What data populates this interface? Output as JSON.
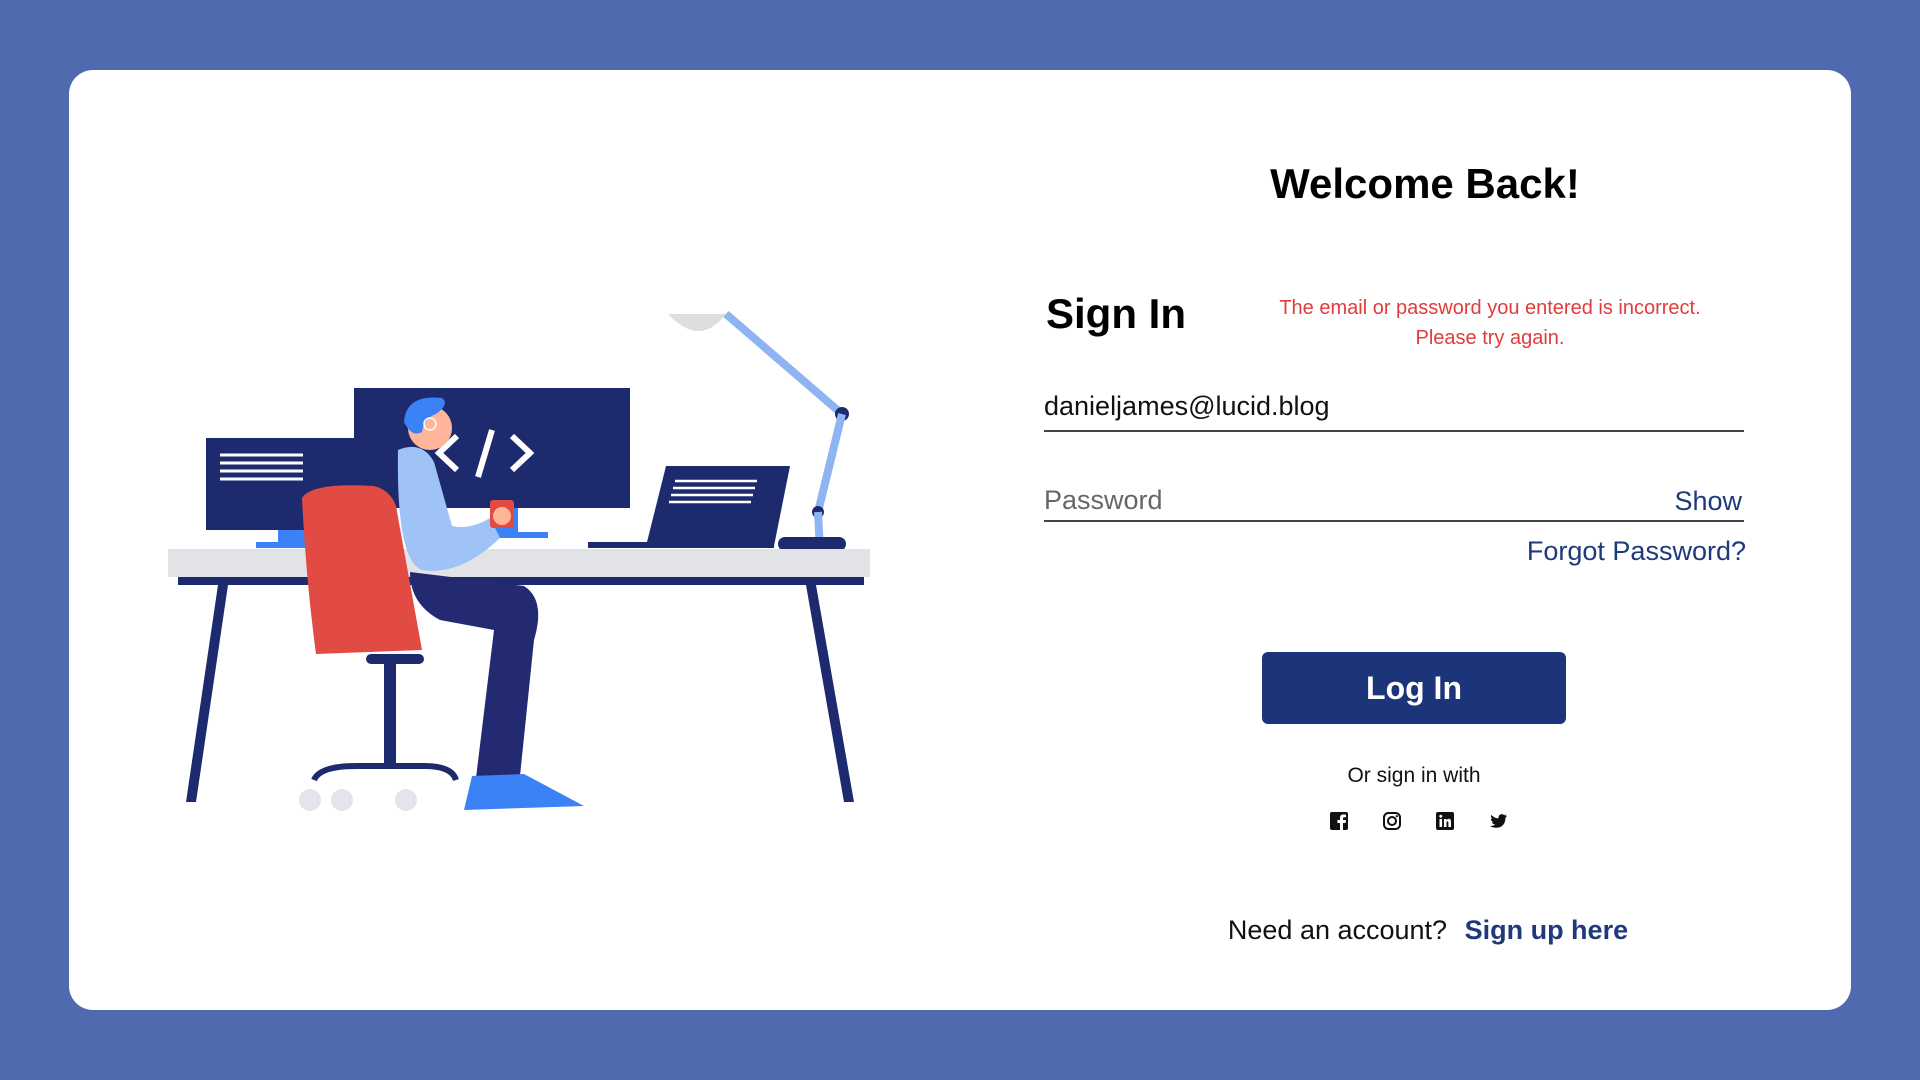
{
  "login": {
    "welcome_title": "Welcome Back!",
    "signin_title": "Sign In",
    "error_line1": "The email or password you entered is incorrect.",
    "error_line2": "Please try again.",
    "email_value": "danieljames@lucid.blog",
    "password_placeholder": "Password",
    "show_label": "Show",
    "forgot_label": "Forgot Password?",
    "login_button_label": "Log In",
    "or_sign_in_with": "Or sign in with",
    "socials": [
      "facebook-icon",
      "instagram-icon",
      "linkedin-icon",
      "twitter-icon"
    ],
    "need_account_text": "Need an account?",
    "signup_label": "Sign up here"
  },
  "colors": {
    "page_background": "#4f6aae",
    "primary": "#1c357a",
    "link": "#1e3a7b",
    "error": "#e23b3b"
  }
}
